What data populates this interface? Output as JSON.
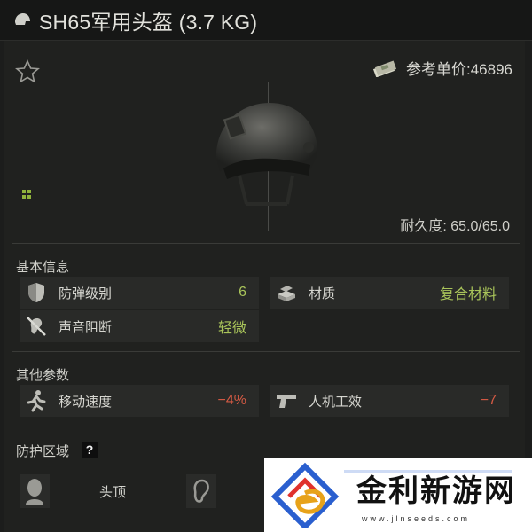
{
  "item": {
    "title": "SH65军用头盔 (3.7 KG)",
    "reference_price_label": "参考单价:46896",
    "durability_label": "耐久度: 65.0/65.0"
  },
  "basic": {
    "title": "基本信息",
    "stats": [
      {
        "label": "防弹级别",
        "value": "6",
        "value_color": "green",
        "icon": "armor-shield-icon"
      },
      {
        "label": "材质",
        "value": "复合材料",
        "value_color": "green",
        "icon": "material-plates-icon"
      },
      {
        "label": "声音阻断",
        "value": "轻微",
        "value_color": "green",
        "icon": "sound-block-icon"
      }
    ]
  },
  "other": {
    "title": "其他参数",
    "stats": [
      {
        "label": "移动速度",
        "value": "−4%",
        "value_color": "red",
        "icon": "running-man-icon"
      },
      {
        "label": "人机工效",
        "value": "−7",
        "value_color": "red",
        "icon": "pistol-icon"
      }
    ]
  },
  "protection": {
    "title": "防护区域",
    "help": "?",
    "zones": [
      {
        "label": "头顶",
        "icon": "head-silhouette-icon"
      },
      {
        "label": "",
        "icon": "ear-icon"
      }
    ]
  },
  "watermark": {
    "text": "金利新游网",
    "url": "www.jlnseeds.com"
  },
  "colors": {
    "positive": "#a9c45a",
    "negative": "#d45a44",
    "background": "#20211f"
  }
}
